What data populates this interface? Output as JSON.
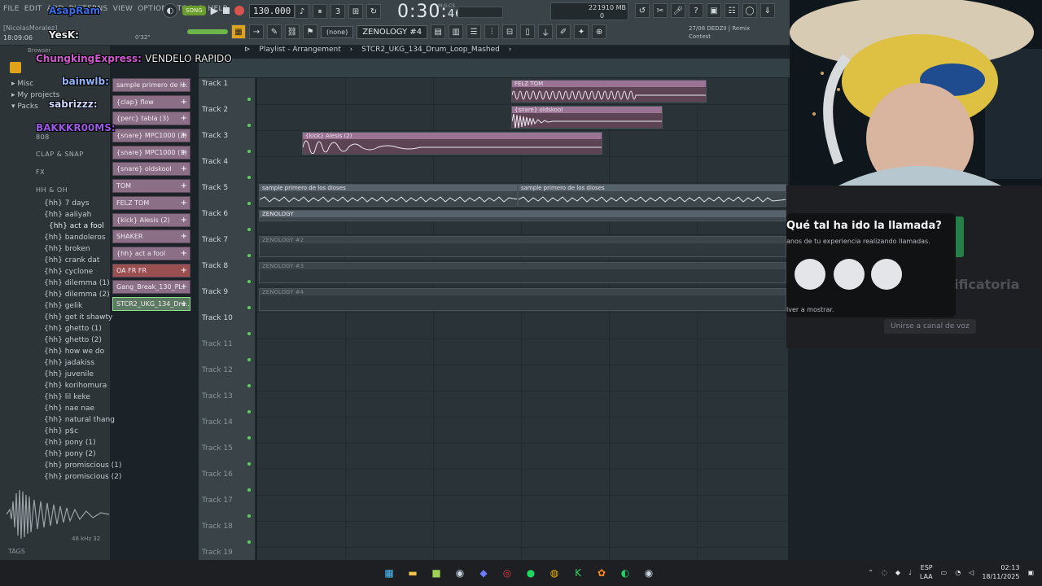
{
  "menu": [
    "FILE",
    "EDIT",
    "ADD",
    "PATTERNS",
    "VIEW",
    "OPTIONS",
    "TOOLS",
    "HELP"
  ],
  "hint": {
    "line": "[NicolasMoralez]",
    "time": "18:09:06",
    "elapsed": "0'32\""
  },
  "transport": {
    "song_label": "SONG",
    "tempo": "130.000",
    "time_main": "0:30",
    "time_sub": "46",
    "mcs": "M:S:CS"
  },
  "cpu": {
    "mem": "1910 MB",
    "poly": "22",
    "zero": "0"
  },
  "pattern": {
    "none": "(none)",
    "instrument": "ZENOLOGY #4"
  },
  "news": {
    "line1": "27/08  DEDZII | Remix",
    "line2": "Contest"
  },
  "browser": {
    "title": "Browser",
    "tree": [
      {
        "label": "Misc",
        "type": "folder"
      },
      {
        "label": "My projects",
        "type": "folder"
      },
      {
        "label": "Packs",
        "type": "folder"
      },
      {
        "label": "808",
        "type": "sub"
      },
      {
        "label": "CLAP & SNAP",
        "type": "sub"
      },
      {
        "label": "FX",
        "type": "sub"
      },
      {
        "label": "HH & OH",
        "type": "open"
      }
    ],
    "files": [
      "{hh} 7 days",
      "{hh} aaliyah",
      "{hh} act a fool",
      "{hh} bandoleros",
      "{hh} broken",
      "{hh} crank dat",
      "{hh} cyclone",
      "{hh} dilemma (1)",
      "{hh} dilemma (2)",
      "{hh} gelik",
      "{hh} get it shawty",
      "{hh} ghetto (1)",
      "{hh} ghetto (2)",
      "{hh} how we do",
      "{hh} jadakiss",
      "{hh} juvenile",
      "{hh} korihomura",
      "{hh} lil keke",
      "{hh} nae nae",
      "{hh} natural thang",
      "{hh} p$c",
      "{hh} pony (1)",
      "{hh} pony (2)",
      "{hh} promiscious (1)",
      "{hh} promiscious (2)"
    ],
    "khz": "48 kHz 32",
    "tags": "TAGS"
  },
  "chat": [
    {
      "user": "AsapRam",
      "msg": "",
      "color": "#3b6fe6"
    },
    {
      "user": "YesK:",
      "msg": "",
      "color": "#e8eef0"
    },
    {
      "user": "ChungkingExpress:",
      "msg": "VENDELO RAPIDO",
      "color": "#d25ad1"
    },
    {
      "user": "bainwlb:",
      "msg": "",
      "color": "#8fb6ff"
    },
    {
      "user": "sabrizzz:",
      "msg": "",
      "color": "#cdd8ff"
    },
    {
      "user": "BAKKKR00MS:",
      "msg": "",
      "color": "#9b59e6"
    }
  ],
  "channels": [
    "sample primero de l...",
    "{clap} flow",
    "{perc} tabla (3)",
    "{snare} MPC1000 (2)",
    "{snare} MPC1000 (1)",
    "{snare} oldskool",
    "TOM",
    "FELZ TOM",
    "{kick} Alesis (2)",
    "SHAKER",
    "{hh} act a fool",
    "OA FR FR",
    "Gang_Break_130_PL",
    "STCR2_UKG_134_Dru..."
  ],
  "playlist": {
    "title": "Playlist - Arrangement",
    "pattern": "STCR2_UKG_134_Drum_Loop_Mashed",
    "tracks": [
      "Track 1",
      "Track 2",
      "Track 3",
      "Track 4",
      "Track 5",
      "Track 6",
      "Track 7",
      "Track 8",
      "Track 9",
      "Track 10",
      "Track 11",
      "Track 12",
      "Track 13",
      "Track 14",
      "Track 15",
      "Track 16",
      "Track 17",
      "Track 18",
      "Track 19"
    ],
    "clips": {
      "felz": "FELZ TOM",
      "snare": "{snare} oldskool",
      "kick": "{kick} Alesis (2)",
      "sample1": "sample primero de los dioses",
      "sample2": "sample primero de los dioses",
      "zen": "ZENOLOGY",
      "zen2": "ZENOLOGY #2",
      "zen3": "ZENOLOGY #3",
      "zen4": "ZENOLOGY #4"
    }
  },
  "popup": {
    "title": "Qué tal ha ido la llamada?",
    "sub": "anos de tu experiencia realizando llamadas.",
    "hint": "lver a mostrar.",
    "bg_text": "ificatoria",
    "bg_button": "Unirse a canal de voz"
  },
  "taskbar": {
    "lang1": "ESP",
    "lang2": "LAA",
    "time": "02:13",
    "date": "18/11/2025"
  }
}
